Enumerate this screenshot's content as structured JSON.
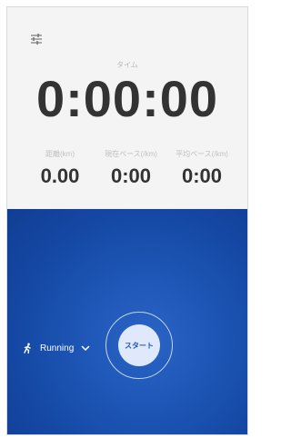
{
  "header": {
    "settings_icon": "sliders-icon"
  },
  "timer": {
    "label": "タイム",
    "value": "0:00:00"
  },
  "stats": [
    {
      "label": "距離(km)",
      "value": "0.00"
    },
    {
      "label": "現在ペース(/km)",
      "value": "0:00"
    },
    {
      "label": "平均ペース(/km)",
      "value": "0:00"
    }
  ],
  "activity": {
    "icon": "running-icon",
    "label": "Running",
    "dropdown_icon": "chevron-down-icon"
  },
  "start_button": {
    "label": "スタート"
  },
  "colors": {
    "top_bg": "#f4f4f4",
    "accent_blue": "#1b50b0",
    "text_dark": "#333333"
  }
}
